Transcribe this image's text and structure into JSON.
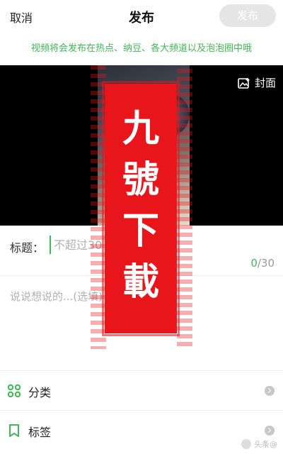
{
  "header": {
    "cancel_label": "取消",
    "title": "发布",
    "publish_label": "发布"
  },
  "notice": "视频将会发布在热点、纳豆、各大频道以及泡泡圈中哦",
  "video": {
    "cover_label": "封面"
  },
  "title_field": {
    "label": "标题：",
    "placeholder": "不超过30",
    "value": "",
    "count_current": "0",
    "count_max": "/30"
  },
  "description_field": {
    "placeholder": "说说想说的...(选填)",
    "value": ""
  },
  "menu": {
    "items": [
      {
        "label": "分类",
        "icon": "grid-dots-icon"
      },
      {
        "label": "标签",
        "icon": "bookmark-icon"
      }
    ]
  },
  "overlay": {
    "seal_text": "九號下載",
    "seal_color": "#e8161b"
  },
  "colors": {
    "accent": "#3cba54",
    "disabled_button": "#e5e5e5"
  },
  "watermark": "头条@"
}
